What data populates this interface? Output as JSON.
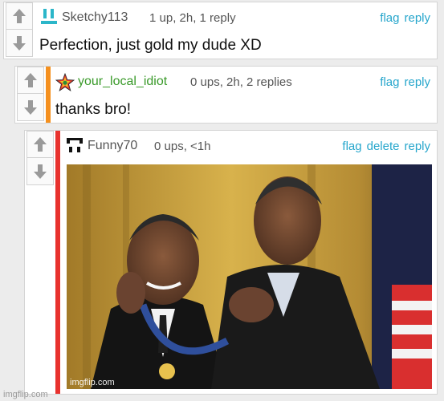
{
  "colors": {
    "accent": "#26a6cc",
    "reply2_bar": "#f5901e",
    "reply3_bar": "#e8322e"
  },
  "comments": [
    {
      "username": "Sketchy113",
      "username_color": "#555555",
      "meta": "1 up, 2h, 1 reply",
      "actions": [
        "flag",
        "reply"
      ],
      "text": "Perfection, just gold my dude XD",
      "avatar_icon": "pixel-face-avatar-icon"
    },
    {
      "username": "your_local_idiot",
      "username_color": "#3a9a2a",
      "meta": "0 ups, 2h, 2 replies",
      "actions": [
        "flag",
        "reply"
      ],
      "text": "thanks bro!",
      "avatar_icon": "rainbow-star-avatar-icon"
    },
    {
      "username": "Funny70",
      "username_color": "#555555",
      "meta": "0 ups, <1h",
      "actions": [
        "flag",
        "delete",
        "reply"
      ],
      "image_icon": "medal-ceremony-meme-image",
      "image_watermark": "imgflip.com",
      "avatar_icon": "pixel-glasses-avatar-icon"
    }
  ],
  "footer_watermark": "imgflip.com"
}
